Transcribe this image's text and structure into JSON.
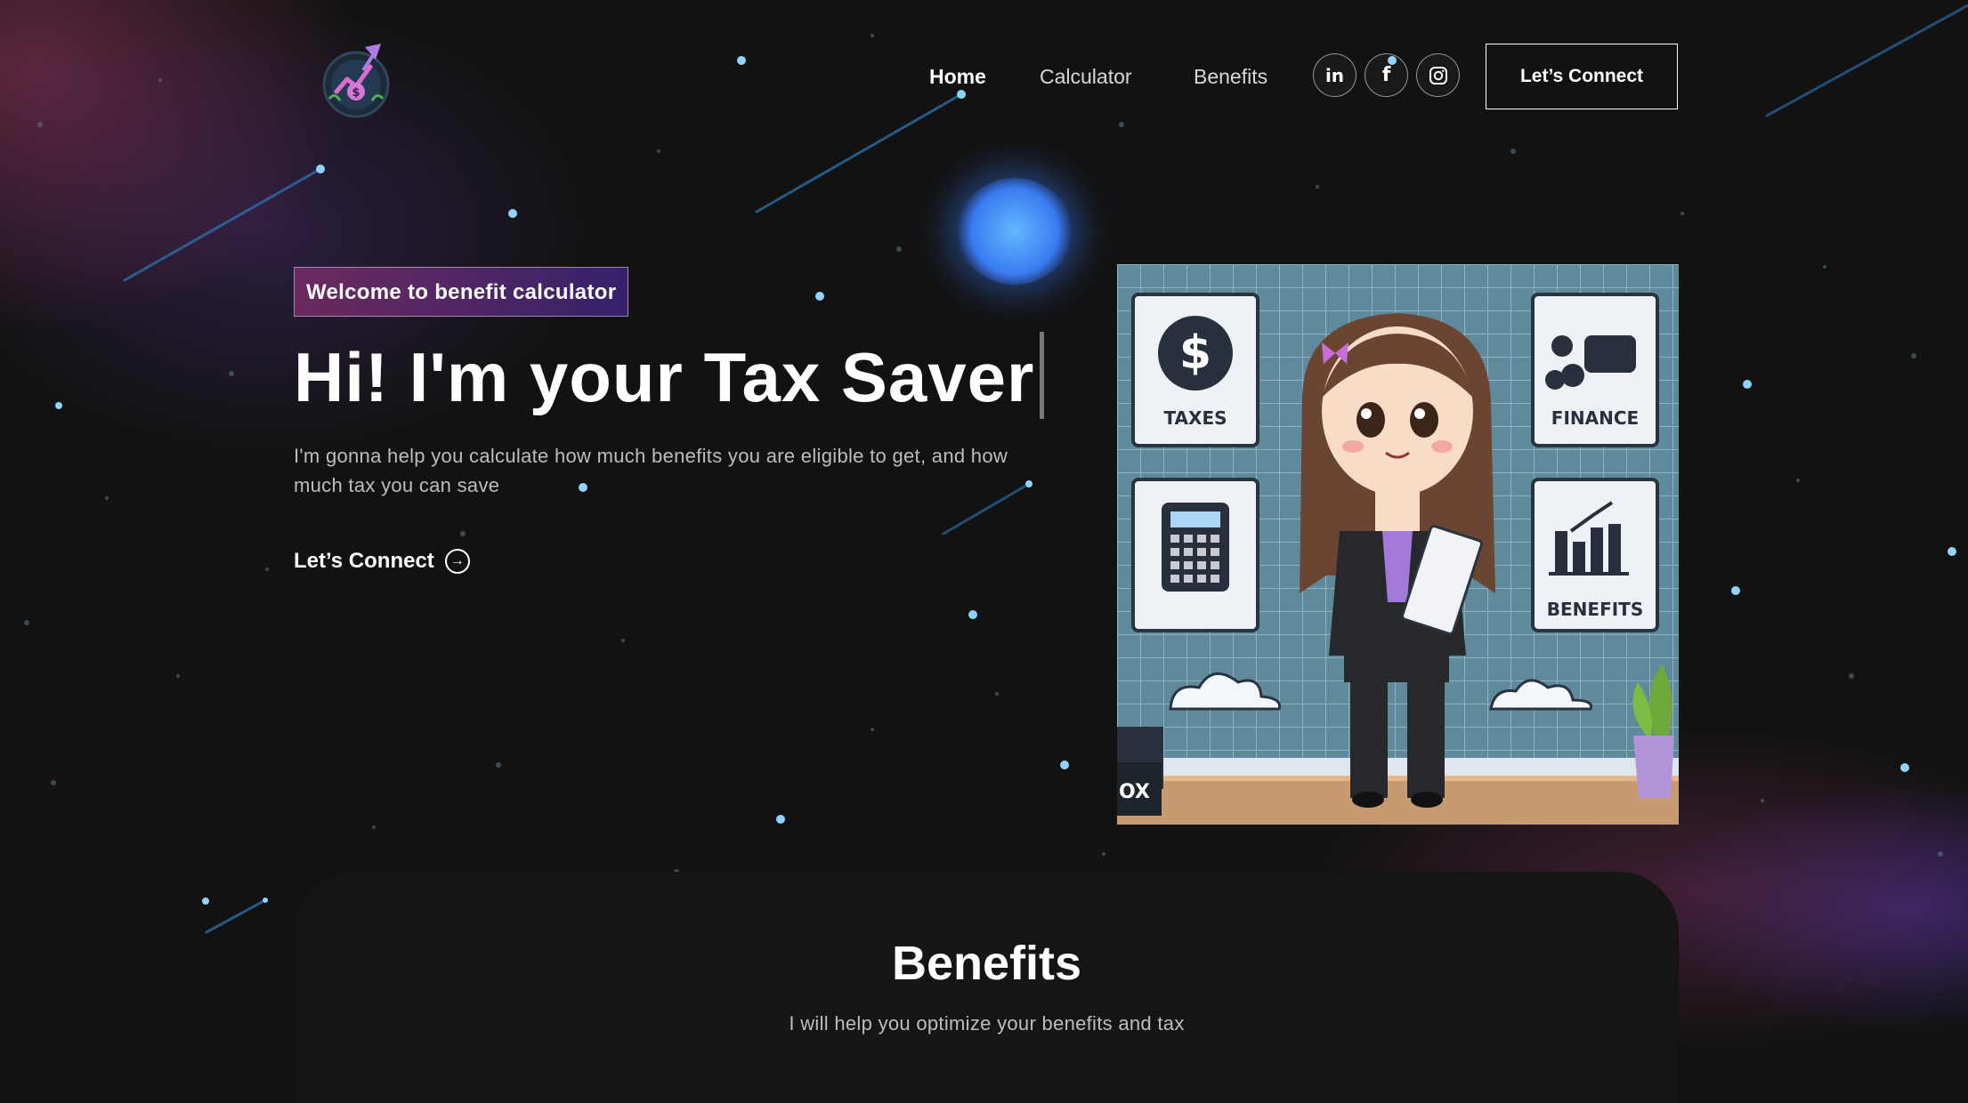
{
  "nav": {
    "links": [
      "Home",
      "Calculator",
      "Benefits"
    ],
    "active": "Home",
    "social": [
      "linkedin-icon",
      "facebook-icon",
      "instagram-icon"
    ],
    "social_glyphs": {
      "linkedin": "in",
      "facebook": "f"
    },
    "cta_label": "Let’s Connect"
  },
  "hero": {
    "tagline": "Welcome to benefit calculator",
    "title": "Hi! I'm your Tax Saver",
    "subtitle": "I'm gonna help you calculate how much benefits you are eligible to get, and how much tax you can save",
    "link_label": "Let’s Connect",
    "link_icon": "arrow-circle-right-icon",
    "illustration": {
      "tiles": [
        "TAXES",
        "FINANCE",
        "BENEFITS"
      ],
      "box_text": "OX",
      "icons": [
        "dollar-icon",
        "coins-icon",
        "calculator-icon",
        "bar-chart-icon"
      ]
    }
  },
  "benefits": {
    "title": "Benefits",
    "subtitle": "I will help you optimize your benefits and tax"
  },
  "colors": {
    "background": "#121212",
    "tagline_gradient_start": "#aa367c",
    "tagline_gradient_end": "#4a2fbd",
    "orb": "#3a7bf0"
  }
}
